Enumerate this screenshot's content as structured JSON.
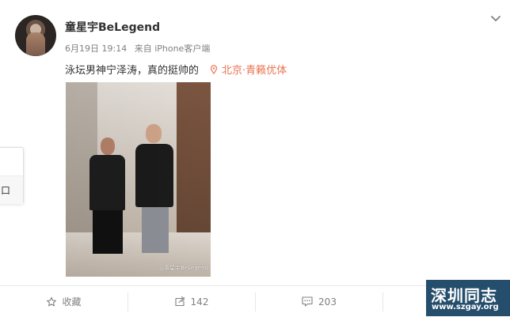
{
  "post": {
    "username": "童星宇BeLegend",
    "date": "6月19日 19:14",
    "source": "来自 iPhone客户端",
    "text": "泳坛男神宁泽涛，真的挺帅的",
    "location": "北京·青籁优体",
    "photo_watermark": "@童星宇BeLegend"
  },
  "floating_panel": {
    "glyph": "口"
  },
  "actions": {
    "favorite": "收藏",
    "repost": "142",
    "comment": "203"
  },
  "site_watermark": {
    "cn": "深圳同志",
    "url": "www.szgay.org"
  },
  "icons": {
    "chevron": "chevron-down-icon",
    "location": "location-pin-icon",
    "favorite": "star-icon",
    "repost": "repost-icon",
    "comment": "comment-icon"
  },
  "colors": {
    "accent": "#eb7350",
    "muted": "#808080",
    "watermark_bg": "#073658"
  }
}
